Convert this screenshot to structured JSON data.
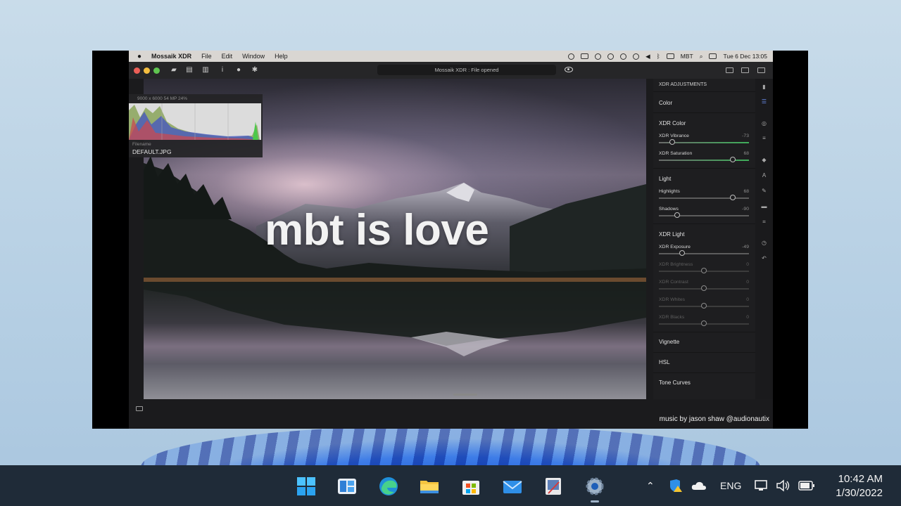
{
  "menubar": {
    "app_name": "Mossaik XDR",
    "items": [
      "File",
      "Edit",
      "Window",
      "Help"
    ],
    "network_label": "MBT",
    "datetime": "Tue 6 Dec 13:05"
  },
  "toolbar": {
    "status": "Mossaik XDR : File opened"
  },
  "histogram": {
    "meta": "9000 x 6000  54 MP  24%",
    "filename_label": "Filename",
    "filename": "DEFAULT.JPG"
  },
  "overlay_text": "mbt is love",
  "panel": {
    "header": "XDR ADJUSTMENTS",
    "color_section": "Color",
    "xdr_color_section": "XDR Color",
    "light_section": "Light",
    "xdr_light_section": "XDR Light",
    "vignette_section": "Vignette",
    "hsl_section": "HSL",
    "tone_curves_section": "Tone Curves",
    "sliders": {
      "xdr_vibrance": {
        "label": "XDR Vibrance",
        "value": "-73",
        "level": 0.15
      },
      "xdr_saturation": {
        "label": "XDR Saturation",
        "value": "68",
        "level": 0.82
      },
      "highlights": {
        "label": "Highlights",
        "value": "68",
        "level": 0.82
      },
      "shadows": {
        "label": "Shadows",
        "value": "-90",
        "level": 0.2
      },
      "xdr_exposure": {
        "label": "XDR Exposure",
        "value": "-49",
        "level": 0.26
      },
      "xdr_brightness": {
        "label": "XDR Brightness",
        "value": "0",
        "level": 0.5
      },
      "xdr_contrast": {
        "label": "XDR Contrast",
        "value": "0",
        "level": 0.5
      },
      "xdr_whites": {
        "label": "XDR Whites",
        "value": "0",
        "level": 0.5
      },
      "xdr_blacks": {
        "label": "XDR Blacks",
        "value": "0",
        "level": 0.5
      }
    }
  },
  "credit": "music by jason shaw @audionautix",
  "taskbar": {
    "language": "ENG",
    "time": "10:42 AM",
    "date": "1/30/2022"
  }
}
